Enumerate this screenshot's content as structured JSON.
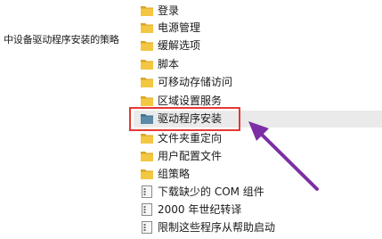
{
  "tree": {
    "node_label": "中设备驱动程序安装的策略"
  },
  "list": {
    "items": [
      {
        "label": "登录",
        "icon": "folder-icon"
      },
      {
        "label": "电源管理",
        "icon": "folder-icon"
      },
      {
        "label": "缓解选项",
        "icon": "folder-icon"
      },
      {
        "label": "脚本",
        "icon": "folder-icon"
      },
      {
        "label": "可移动存储访问",
        "icon": "folder-icon"
      },
      {
        "label": "区域设置服务",
        "icon": "folder-icon"
      },
      {
        "label": "驱动程序安装",
        "icon": "folder-open-icon",
        "selected": true
      },
      {
        "label": "文件夹重定向",
        "icon": "folder-icon"
      },
      {
        "label": "用户配置文件",
        "icon": "folder-icon"
      },
      {
        "label": "组策略",
        "icon": "folder-icon"
      },
      {
        "label": "下载缺少的 COM 组件",
        "icon": "policy-setting-icon"
      },
      {
        "label": "2000 年世纪转译",
        "icon": "policy-setting-icon"
      },
      {
        "label": "限制这些程序从帮助启动",
        "icon": "policy-setting-icon"
      }
    ]
  },
  "colors": {
    "folder": "#f3c742",
    "folder_dark": "#d9a521",
    "selected_folder": "#5c8aa8",
    "highlight_border": "#e53935",
    "arrow": "#7b2fa6",
    "selection_bg": "#eaeaea"
  }
}
